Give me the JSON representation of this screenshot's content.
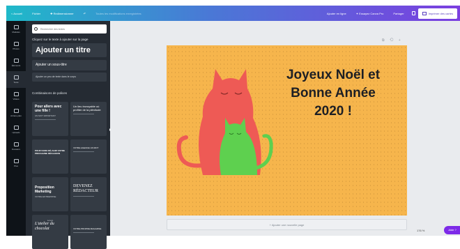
{
  "topbar": {
    "home": "< Accueil",
    "file": "Fichier",
    "resize": "✚ Redimensionner",
    "undo": "↶",
    "status": "Toutes les modifications enregistrées",
    "add_editors": "Ajouter en ligne",
    "try_pro": "✦ Essayez Canva Pro",
    "share": "Partager",
    "print": "Imprimer des cartes"
  },
  "rail": [
    {
      "label": "Modèles"
    },
    {
      "label": "Photos"
    },
    {
      "label": "Éléments"
    },
    {
      "label": "Texte"
    },
    {
      "label": "Vidéos"
    },
    {
      "label": "Arrière-plan"
    },
    {
      "label": "Uploads"
    },
    {
      "label": "Dossiers"
    },
    {
      "label": "Plus"
    }
  ],
  "panel": {
    "search_placeholder": "Rechercher des textes",
    "hint": "Cliquez sur le texte à ajouter sur la page",
    "title_btn": "Ajouter un titre",
    "subtitle_btn": "Ajouter un sous-titre",
    "body_btn": "Ajouter un peu de texte dans le corps",
    "combos_heading": "Combinaisons de polices",
    "tiles": [
      {
        "main": "Pour allers avec une fille !",
        "sub": "UN MOT IMPORTANT"
      },
      {
        "main": "Un lieu incroyable où profiter de la plénitude",
        "sub": ""
      },
      {
        "main": "POUR FAIRE RÉ-AGIR VOTRE PROCHAINE RÉFLEXION",
        "sub": ""
      },
      {
        "main": "VOTRE AGENCE UN MOT",
        "sub": ""
      },
      {
        "main": "Proposition Marketing",
        "sub": "VOTRE ENTREPRISE"
      },
      {
        "main": "DEVENEZ RÉDACTEUR",
        "sub": ""
      },
      {
        "main": "L'atelier du chocolat",
        "sub": "Lorem"
      },
      {
        "main": "VOTRE PROPRE MAGAZINE",
        "sub": ""
      }
    ]
  },
  "card": {
    "line1": "Joyeux Noël et",
    "line2": "Bonne Année",
    "line3": "2020 !",
    "bg_color": "#f6b54c",
    "cat_big_color": "#ee5a55",
    "cat_small_color": "#5ed04f"
  },
  "page_tools": "⧉ ⟲ +",
  "add_page": "+ Ajouter une nouvelle page",
  "zoom": "176 %",
  "help": "Aide ?"
}
